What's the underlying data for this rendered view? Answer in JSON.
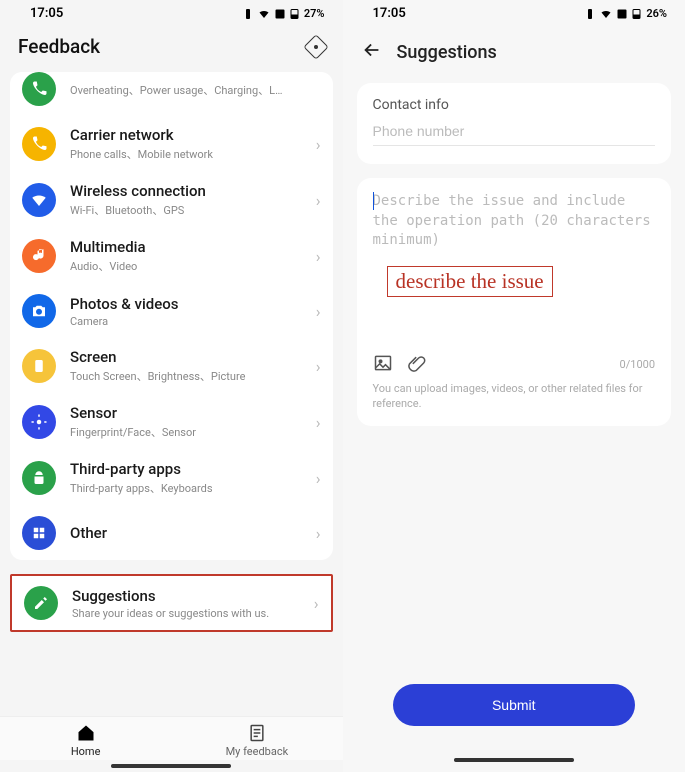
{
  "left": {
    "status": {
      "time": "17:05",
      "battery": "27%"
    },
    "header": {
      "title": "Feedback"
    },
    "list": {
      "cutoff": {
        "sub": "Overheating、Power usage、Charging、L…"
      },
      "items": [
        {
          "title": "Carrier network",
          "sub": "Phone calls、Mobile network"
        },
        {
          "title": "Wireless connection",
          "sub": "Wi-Fi、Bluetooth、GPS"
        },
        {
          "title": "Multimedia",
          "sub": "Audio、Video"
        },
        {
          "title": "Photos & videos",
          "sub": "Camera"
        },
        {
          "title": "Screen",
          "sub": "Touch Screen、Brightness、Picture"
        },
        {
          "title": "Sensor",
          "sub": "Fingerprint/Face、Sensor"
        },
        {
          "title": "Third-party apps",
          "sub": "Third-party apps、Keyboards"
        },
        {
          "title": "Other",
          "sub": ""
        }
      ]
    },
    "suggestions": {
      "title": "Suggestions",
      "sub": "Share your ideas or suggestions with us."
    },
    "nav": {
      "home": "Home",
      "myfeedback": "My feedback"
    }
  },
  "right": {
    "status": {
      "time": "17:05",
      "battery": "26%"
    },
    "header": {
      "title": "Suggestions"
    },
    "contact": {
      "label": "Contact info",
      "placeholder": "Phone number"
    },
    "describe": {
      "placeholder": "Describe the issue and include the operation path (20 characters minimum)",
      "overlay": "describe the issue",
      "counter": "0/1000",
      "uploadNote": "You can upload images, videos, or other related files for reference."
    },
    "submit": "Submit"
  }
}
